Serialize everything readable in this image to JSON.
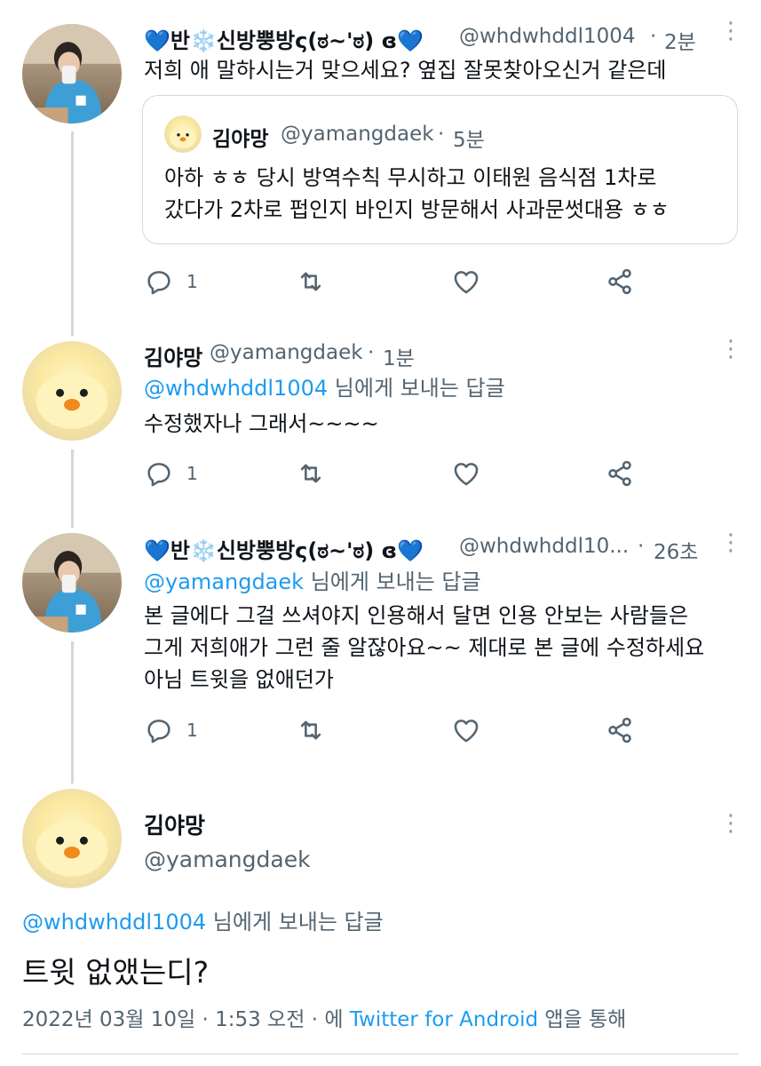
{
  "tweets": [
    {
      "display_name": "💙반❄️신방뿡방ς(ಠ~'ಠ) ɞ💙",
      "handle": "@whdwhddl1004",
      "time": "2분",
      "text": "저희 애 말하시는거 맞으세요? 옆집 잘못찾아오신거 같은데",
      "quote": {
        "display_name": "김야망",
        "handle": "@yamangdaek",
        "time": "5분",
        "lines": [
          "아하 ㅎㅎ 당시 방역수칙 무시하고 이태원 음식점 1차로",
          "갔다가 2차로 펍인지 바인지 방문해서 사과문썻대용 ㅎㅎ"
        ]
      },
      "reply_count": "1"
    },
    {
      "display_name": "김야망",
      "handle": "@yamangdaek",
      "time": "1분",
      "reply_to_handle": "@whdwhddl1004",
      "reply_to_suffix": "님에게 보내는 답글",
      "text": "수정했자나 그래서~~~~",
      "reply_count": "1"
    },
    {
      "display_name": "💙반❄️신방뿡방ς(ಠ~'ಠ) ɞ💙",
      "handle": "@whdwhddl10...",
      "time": "26초",
      "reply_to_handle": "@yamangdaek",
      "reply_to_suffix": "님에게 보내는 답글",
      "lines": [
        "본 글에다 그걸 쓰셔야지 인용해서 달면 인용 안보는 사람들은",
        "그게 저희애가 그런 줄 알잖아요~~ 제대로 본 글에 수정하세요",
        "아님 트윗을 없애던가"
      ],
      "reply_count": "1"
    }
  ],
  "main_tweet": {
    "display_name": "김야망",
    "handle": "@yamangdaek",
    "reply_to_handle": "@whdwhddl1004",
    "reply_to_suffix": "님에게 보내는 답글",
    "text": "트윗 없앴는디?",
    "date": "2022년 03월 10일 · 1:53 오전 · 에",
    "source": "Twitter for Android",
    "source_suffix": "앱을 통해"
  },
  "colors": {
    "accent": "#1d9bf0",
    "secondary_text": "#536471",
    "divider": "#cfd9de",
    "heart_blue": "#4fa3e8"
  },
  "icons": [
    "reply-icon",
    "retweet-icon",
    "like-icon",
    "share-icon",
    "more-icon",
    "snowflake-icon",
    "blue-heart-icon"
  ]
}
